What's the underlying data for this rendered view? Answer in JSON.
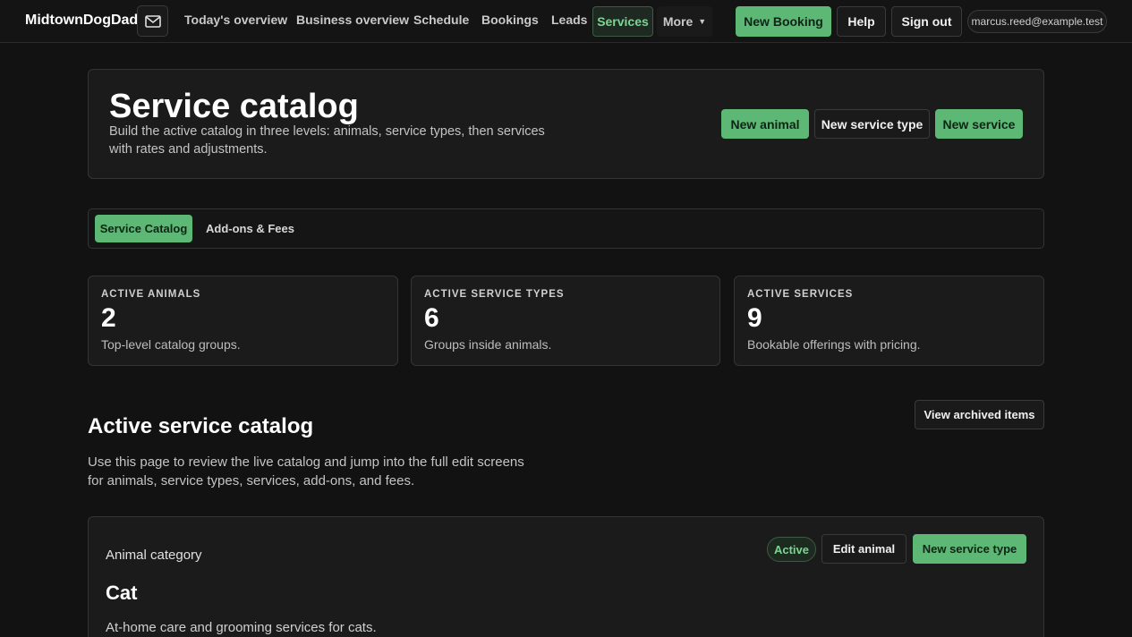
{
  "nav": {
    "brand": "MidtownDogDad",
    "mail_icon": "envelope-icon",
    "links": [
      "Today's overview",
      "Business overview",
      "Schedule",
      "Bookings",
      "Leads"
    ],
    "services": "Services",
    "more": "More",
    "new_booking": "New Booking",
    "help": "Help",
    "sign_out": "Sign out",
    "email": "marcus.reed@example.test"
  },
  "hero": {
    "title": "Service catalog",
    "subtitle": "Build the active catalog in three levels: animals, service types, then services with rates and adjustments.",
    "new_animal": "New animal",
    "new_service_type": "New service type",
    "new_service": "New service"
  },
  "tabs": {
    "active": "Service Catalog",
    "other": "Add-ons & Fees"
  },
  "stats": [
    {
      "label": "ACTIVE ANIMALS",
      "value": "2",
      "desc": "Top-level catalog groups."
    },
    {
      "label": "ACTIVE SERVICE TYPES",
      "value": "6",
      "desc": "Groups inside animals."
    },
    {
      "label": "ACTIVE SERVICES",
      "value": "9",
      "desc": "Bookable offerings with pricing."
    }
  ],
  "section": {
    "title": "Active service catalog",
    "desc": "Use this page to review the live catalog and jump into the full edit screens for animals, service types, services, add-ons, and fees.",
    "view_archived": "View archived items"
  },
  "animal": {
    "category_label": "Animal category",
    "name": "Cat",
    "desc": "At-home care and grooming services for cats.",
    "status": "Active",
    "edit": "Edit animal",
    "new_service_type": "New service type"
  },
  "colors": {
    "accent": "#5cb874",
    "background": "#121212",
    "card": "#1b1b1b"
  }
}
